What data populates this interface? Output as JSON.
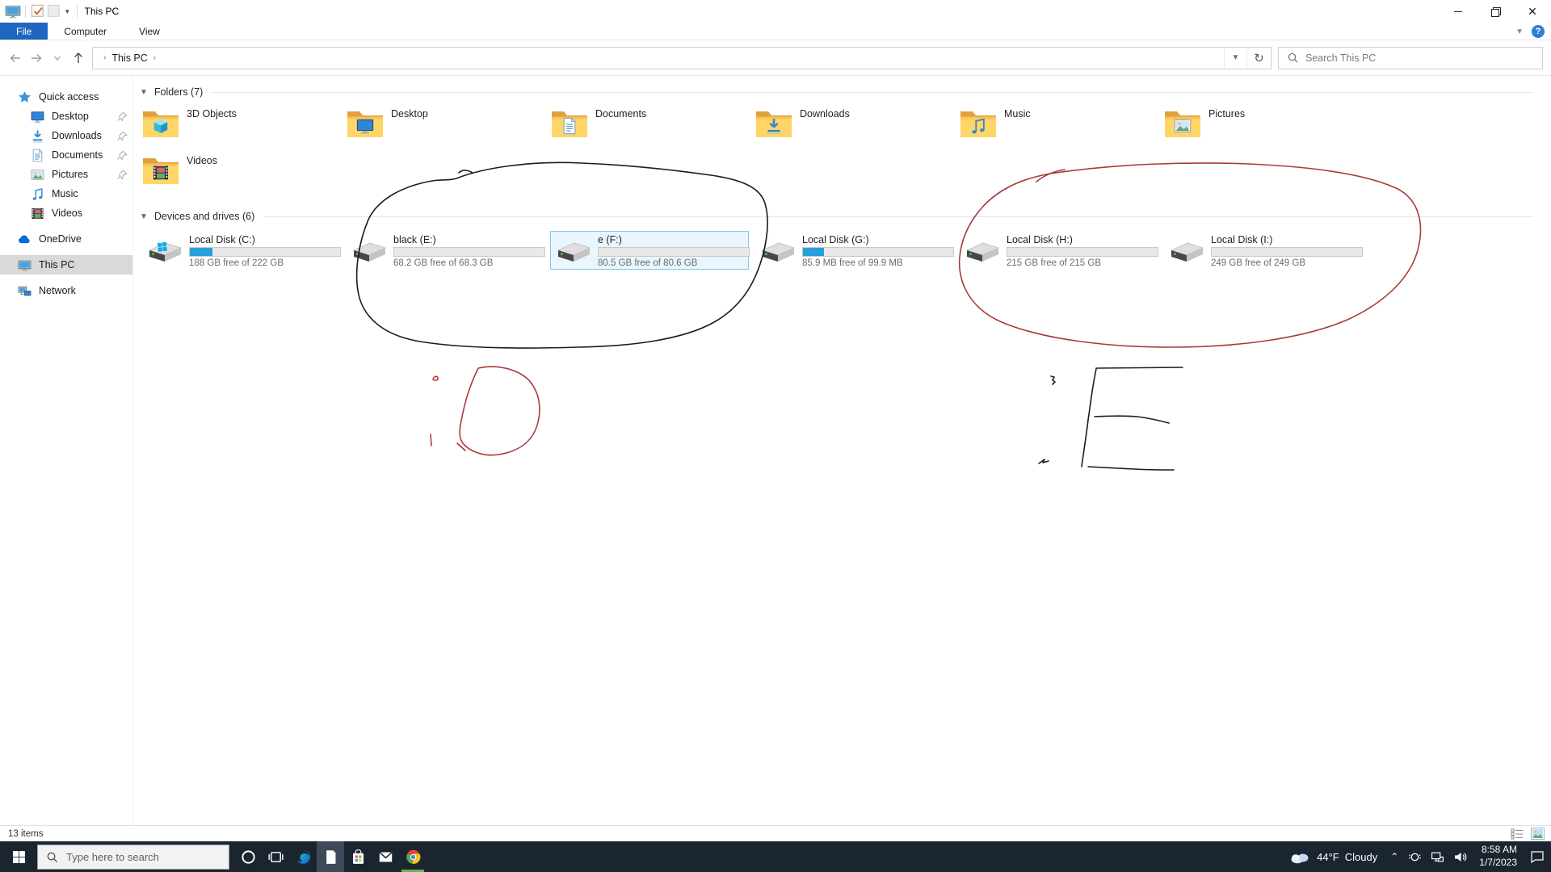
{
  "window": {
    "title": "This PC",
    "controls": [
      "minimize",
      "restore",
      "close"
    ]
  },
  "menu": {
    "tabs": [
      {
        "label": "File",
        "active": true
      },
      {
        "label": "Computer",
        "active": false
      },
      {
        "label": "View",
        "active": false
      }
    ],
    "help_label": "?"
  },
  "address_bar": {
    "breadcrumb_label": "This PC",
    "search_placeholder": "Search This PC"
  },
  "sidebar": {
    "items": [
      {
        "label": "Quick access",
        "icon": "star-icon",
        "level": 0
      },
      {
        "label": "Desktop",
        "icon": "monitor-icon",
        "level": 1,
        "pinned": true
      },
      {
        "label": "Downloads",
        "icon": "download-icon",
        "level": 1,
        "pinned": true
      },
      {
        "label": "Documents",
        "icon": "document-icon",
        "level": 1,
        "pinned": true
      },
      {
        "label": "Pictures",
        "icon": "picture-icon",
        "level": 1,
        "pinned": true
      },
      {
        "label": "Music",
        "icon": "music-icon",
        "level": 1
      },
      {
        "label": "Videos",
        "icon": "film-icon",
        "level": 1
      },
      {
        "label": "OneDrive",
        "icon": "cloud-icon",
        "level": 0,
        "gap_before": true
      },
      {
        "label": "This PC",
        "icon": "computer-icon",
        "level": 0,
        "gap_before": true,
        "selected": true
      },
      {
        "label": "Network",
        "icon": "network-icon",
        "level": 0,
        "gap_before": true
      }
    ]
  },
  "content": {
    "groups": [
      {
        "label": "Folders (7)"
      },
      {
        "label": "Devices and drives (6)"
      }
    ],
    "folders": [
      {
        "name": "3D Objects",
        "icon": "cube"
      },
      {
        "name": "Desktop",
        "icon": "monitor-icon"
      },
      {
        "name": "Documents",
        "icon": "document-icon"
      },
      {
        "name": "Downloads",
        "icon": "download-icon"
      },
      {
        "name": "Music",
        "icon": "music-icon"
      },
      {
        "name": "Pictures",
        "icon": "picture-icon"
      },
      {
        "name": "Videos",
        "icon": "film-icon"
      }
    ],
    "drives": [
      {
        "name": "Local Disk (C:)",
        "free_text": "188 GB free of 222 GB",
        "used_pct": 15,
        "windows_logo": true,
        "selected": false
      },
      {
        "name": "black (E:)",
        "free_text": "68.2 GB free of 68.3 GB",
        "used_pct": 0,
        "windows_logo": false,
        "selected": false
      },
      {
        "name": "e (F:)",
        "free_text": "80.5 GB free of 80.6 GB",
        "used_pct": 0,
        "windows_logo": false,
        "selected": true
      },
      {
        "name": "Local Disk (G:)",
        "free_text": "85.9 MB free of 99.9 MB",
        "used_pct": 14,
        "windows_logo": false,
        "selected": false
      },
      {
        "name": "Local Disk (H:)",
        "free_text": "215 GB free of 215 GB",
        "used_pct": 0,
        "windows_logo": false,
        "selected": false
      },
      {
        "name": "Local Disk (I:)",
        "free_text": "249 GB free of 249 GB",
        "used_pct": 0,
        "windows_logo": false,
        "selected": false
      }
    ]
  },
  "status_bar": {
    "items_count": "13 items"
  },
  "taskbar": {
    "search_placeholder": "Type here to search",
    "apps": [
      {
        "name": "cortana"
      },
      {
        "name": "task-view"
      },
      {
        "name": "edge"
      },
      {
        "name": "notepad",
        "active": true
      },
      {
        "name": "store"
      },
      {
        "name": "mail"
      },
      {
        "name": "chrome",
        "running": true
      }
    ],
    "weather": {
      "temp": "44°F",
      "condition": "Cloudy"
    },
    "clock": {
      "time": "8:58 AM",
      "date": "1/7/2023"
    }
  },
  "annotations": {
    "ink_colors": {
      "black": "#1c1c1c",
      "red": "#a93a3a"
    },
    "shapes": [
      {
        "name": "black-loop-around-black-e-and-e-f-drives",
        "color": "black"
      },
      {
        "name": "red-loop-around-local-disk-h-and-i-drives",
        "color": "red"
      },
      {
        "name": "red-letter-d-sketch",
        "color": "red"
      },
      {
        "name": "black-letter-e-sketch",
        "color": "black"
      }
    ]
  }
}
